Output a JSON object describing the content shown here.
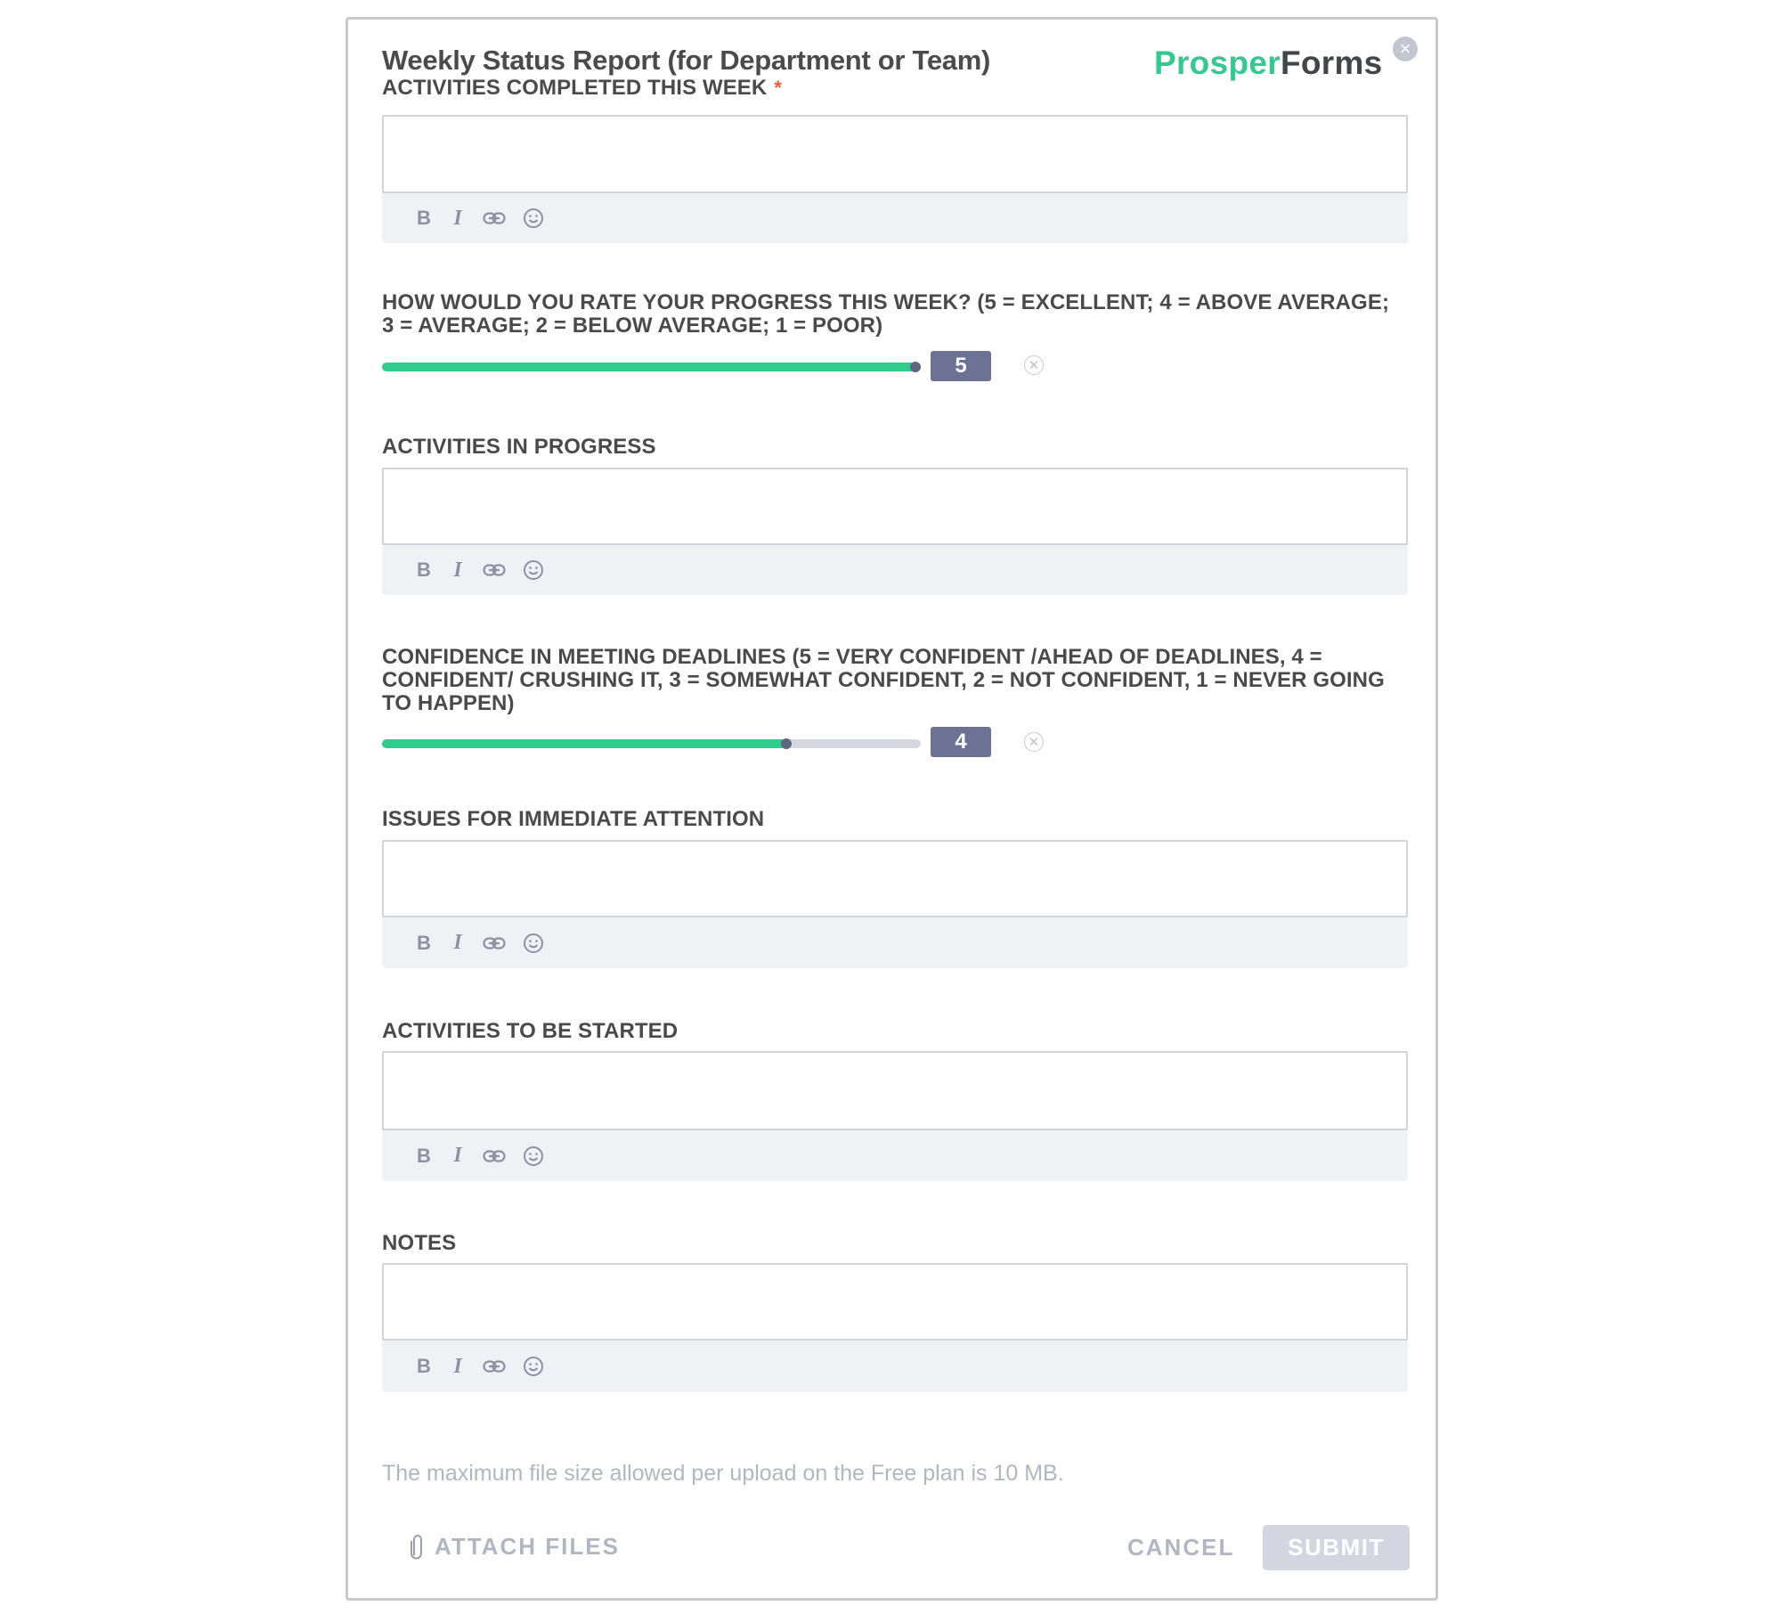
{
  "header": {
    "title": "Weekly Status Report (for Department or Team)",
    "logo_part1": "Prosper",
    "logo_part2": "Forms",
    "close_label": "×"
  },
  "colors": {
    "accent_green": "#2fcd8c",
    "value_box": "#6b7294",
    "required_star": "#ee5b3a",
    "submit_disabled": "#d3d6e0"
  },
  "toolbar": {
    "bold": "B",
    "italic": "I",
    "link_icon": "link-icon",
    "emoji_icon": "emoji-icon"
  },
  "fields": [
    {
      "label": "ACTIVITIES COMPLETED THIS WEEK",
      "required": "*",
      "type": "rich-text",
      "value": ""
    },
    {
      "label": "HOW WOULD YOU RATE YOUR PROGRESS THIS WEEK? (5 = EXCELLENT; 4 = ABOVE AVERAGE; 3 = AVERAGE; 2 = BELOW AVERAGE; 1 = POOR)",
      "type": "slider",
      "min": 1,
      "max": 5,
      "value": 5,
      "value_label": "5"
    },
    {
      "label": "ACTIVITIES IN PROGRESS",
      "type": "rich-text",
      "value": ""
    },
    {
      "label": "CONFIDENCE IN MEETING DEADLINES (5 = VERY CONFIDENT /AHEAD OF DEADLINES, 4 = CONFIDENT/ CRUSHING IT, 3 = SOMEWHAT CONFIDENT, 2 = NOT CONFIDENT, 1 = NEVER GOING TO HAPPEN)",
      "type": "slider",
      "min": 1,
      "max": 5,
      "value": 4,
      "value_label": "4"
    },
    {
      "label": "ISSUES FOR IMMEDIATE ATTENTION",
      "type": "rich-text",
      "value": ""
    },
    {
      "label": "ACTIVITIES TO BE STARTED",
      "type": "rich-text",
      "value": ""
    },
    {
      "label": "NOTES",
      "type": "rich-text",
      "value": ""
    }
  ],
  "footer": {
    "file_size_note": "The maximum file size allowed per upload on the Free plan is 10 MB.",
    "attach_label": "ATTACH FILES",
    "cancel_label": "CANCEL",
    "submit_label": "SUBMIT"
  }
}
